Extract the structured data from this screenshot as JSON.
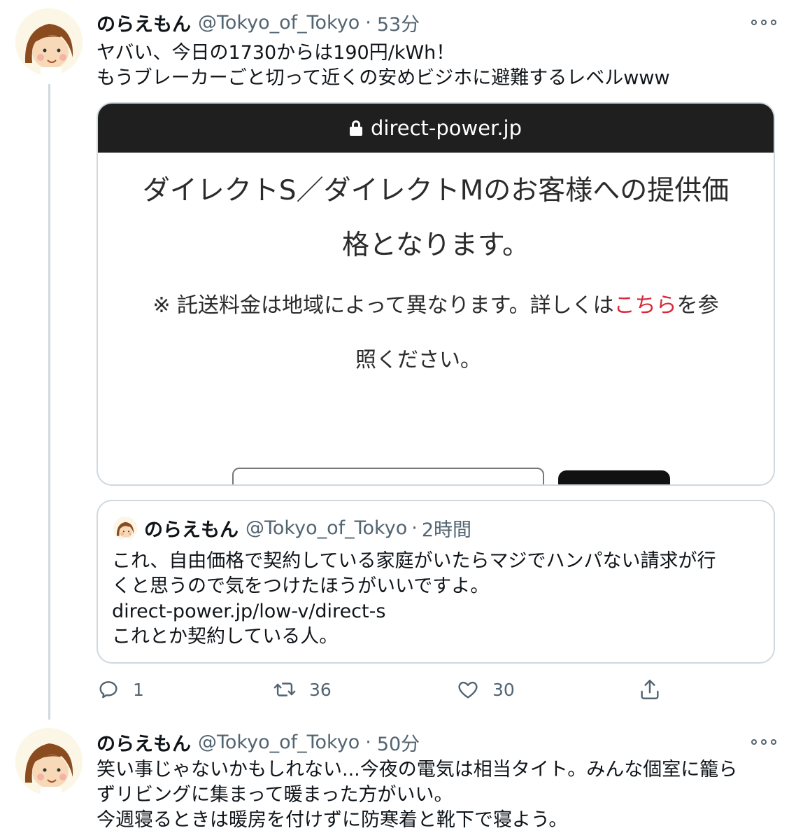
{
  "tweet1": {
    "name": "のらえもん",
    "handle": "@Tokyo_of_Tokyo",
    "separator": "·",
    "time": "53分",
    "lines": [
      "ヤバい、今日の1730からは190円/kWh！",
      "もうブレーカーごと切って近くの安めビジホに避難するレベルwww"
    ]
  },
  "screenshot": {
    "url": "direct-power.jp",
    "heading_line1": "ダイレクトS／ダイレクトMのお客様への提供価",
    "heading_line2": "格となります。",
    "note_prefix": "※ 託送料金は地域によって異なります。詳しくは",
    "note_link": "こちら",
    "note_suffix": "を参",
    "note_line2": "照ください。"
  },
  "quote": {
    "name": "のらえもん",
    "handle": "@Tokyo_of_Tokyo",
    "separator": "·",
    "time": "2時間",
    "lines": [
      "これ、自由価格で契約している家庭がいたらマジでハンパない請求が行",
      "くと思うので気をつけたほうがいいですよ。",
      "direct-power.jp/low-v/direct-s",
      "これとか契約している人。"
    ]
  },
  "actions": {
    "reply_count": "1",
    "retweet_count": "36",
    "like_count": "30",
    "icons": [
      "reply-icon",
      "retweet-icon",
      "like-icon",
      "share-icon"
    ]
  },
  "tweet2": {
    "name": "のらえもん",
    "handle": "@Tokyo_of_Tokyo",
    "separator": "·",
    "time": "50分",
    "lines": [
      "笑い事じゃないかもしれない...今夜の電気は相当タイト。みんな個室に籠ら",
      "ずリビングに集まって暖まった方がいい。",
      "今週寝るときは暖房を付けずに防寒着と靴下で寝よう。"
    ]
  },
  "colors": {
    "text": "#0f1419",
    "secondary": "#536471",
    "border": "#cfd9de",
    "link_red": "#d8283a",
    "browser_bar": "#1f1f1f"
  }
}
